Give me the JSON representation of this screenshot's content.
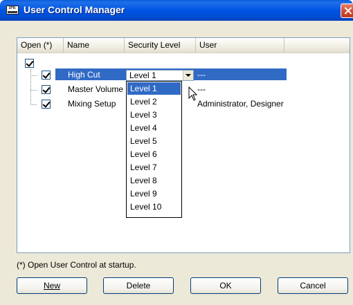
{
  "window": {
    "title": "User Control Manager",
    "app_icon_text": "DME"
  },
  "table": {
    "columns": [
      {
        "label": "Open (*)"
      },
      {
        "label": "Name"
      },
      {
        "label": "Security Level"
      },
      {
        "label": "User"
      }
    ],
    "rows": [
      {
        "name": "High Cut",
        "security": "Level 1",
        "user": "---",
        "checked": true,
        "selected": true
      },
      {
        "name": "Master Volume",
        "security": "",
        "user": "---",
        "checked": true,
        "selected": false
      },
      {
        "name": "Mixing Setup",
        "security": "",
        "user": "Administrator, Designer",
        "checked": true,
        "selected": false
      }
    ]
  },
  "dropdown": {
    "options": [
      "Level 1",
      "Level 2",
      "Level 3",
      "Level 4",
      "Level 5",
      "Level 6",
      "Level 7",
      "Level 8",
      "Level 9",
      "Level 10"
    ],
    "highlighted": "Level 1"
  },
  "footnote": "(*) Open User Control at startup.",
  "buttons": {
    "new_label": "New",
    "delete_label": "Delete",
    "ok_label": "OK",
    "cancel_label": "Cancel"
  },
  "colors": {
    "selection": "#316ac5",
    "titlebar": "#0054e3",
    "dialog_bg": "#ece9d8"
  }
}
